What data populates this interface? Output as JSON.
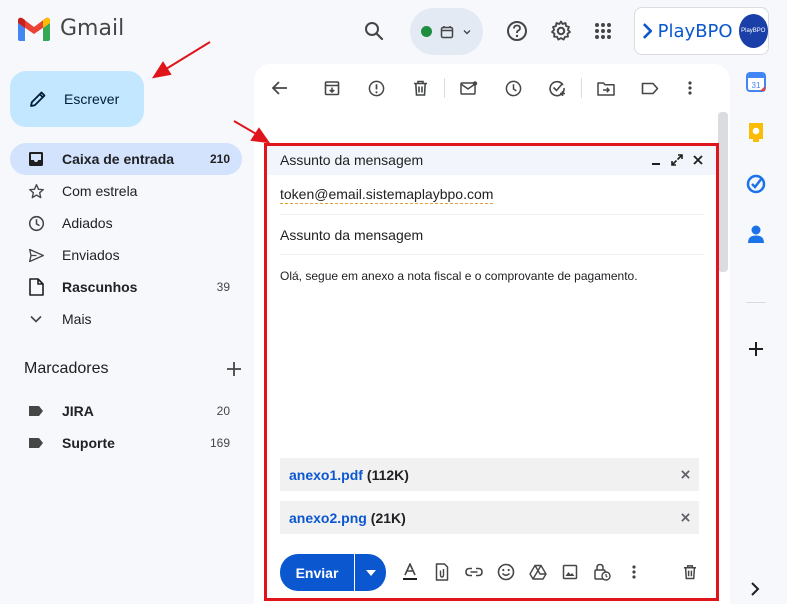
{
  "app": {
    "name": "Gmail"
  },
  "brand": {
    "name": "PlayBPO",
    "badge": "PlayBPO"
  },
  "sidebar": {
    "compose_label": "Escrever",
    "items": [
      {
        "label": "Caixa de entrada",
        "count": "210"
      },
      {
        "label": "Com estrela",
        "count": ""
      },
      {
        "label": "Adiados",
        "count": ""
      },
      {
        "label": "Enviados",
        "count": ""
      },
      {
        "label": "Rascunhos",
        "count": "39"
      },
      {
        "label": "Mais",
        "count": ""
      }
    ],
    "labels_title": "Marcadores",
    "labels": [
      {
        "label": "JIRA",
        "count": "20"
      },
      {
        "label": "Suporte",
        "count": "169"
      }
    ]
  },
  "compose_window": {
    "title": "Assunto da mensagem",
    "to": "token@email.sistemaplaybpo.com",
    "subject": "Assunto da mensagem",
    "body": "Olá, segue em anexo a nota fiscal e o comprovante de pagamento.",
    "attachments": [
      {
        "name": "anexo1.pdf",
        "size": "(112K)"
      },
      {
        "name": "anexo2.png",
        "size": "(21K)"
      }
    ],
    "send_label": "Enviar"
  },
  "colors": {
    "accent": "#0b57d0",
    "highlight": "#e0141b",
    "compose_bg": "#c2e7ff",
    "active_nav": "#d3e3fd"
  }
}
